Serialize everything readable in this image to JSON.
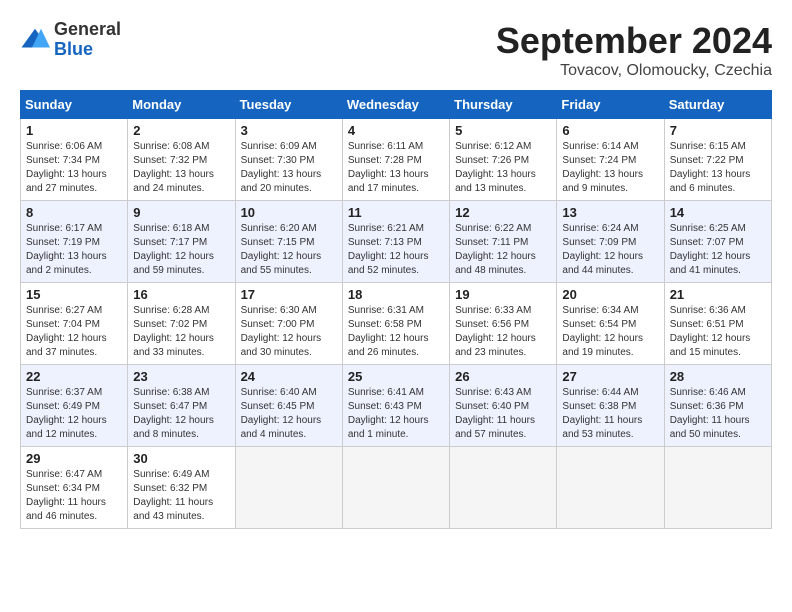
{
  "logo": {
    "text_general": "General",
    "text_blue": "Blue"
  },
  "title": "September 2024",
  "location": "Tovacov, Olomoucky, Czechia",
  "days_of_week": [
    "Sunday",
    "Monday",
    "Tuesday",
    "Wednesday",
    "Thursday",
    "Friday",
    "Saturday"
  ],
  "weeks": [
    [
      {
        "num": "1",
        "sunrise": "Sunrise: 6:06 AM",
        "sunset": "Sunset: 7:34 PM",
        "daylight": "Daylight: 13 hours and 27 minutes."
      },
      {
        "num": "2",
        "sunrise": "Sunrise: 6:08 AM",
        "sunset": "Sunset: 7:32 PM",
        "daylight": "Daylight: 13 hours and 24 minutes."
      },
      {
        "num": "3",
        "sunrise": "Sunrise: 6:09 AM",
        "sunset": "Sunset: 7:30 PM",
        "daylight": "Daylight: 13 hours and 20 minutes."
      },
      {
        "num": "4",
        "sunrise": "Sunrise: 6:11 AM",
        "sunset": "Sunset: 7:28 PM",
        "daylight": "Daylight: 13 hours and 17 minutes."
      },
      {
        "num": "5",
        "sunrise": "Sunrise: 6:12 AM",
        "sunset": "Sunset: 7:26 PM",
        "daylight": "Daylight: 13 hours and 13 minutes."
      },
      {
        "num": "6",
        "sunrise": "Sunrise: 6:14 AM",
        "sunset": "Sunset: 7:24 PM",
        "daylight": "Daylight: 13 hours and 9 minutes."
      },
      {
        "num": "7",
        "sunrise": "Sunrise: 6:15 AM",
        "sunset": "Sunset: 7:22 PM",
        "daylight": "Daylight: 13 hours and 6 minutes."
      }
    ],
    [
      {
        "num": "8",
        "sunrise": "Sunrise: 6:17 AM",
        "sunset": "Sunset: 7:19 PM",
        "daylight": "Daylight: 13 hours and 2 minutes."
      },
      {
        "num": "9",
        "sunrise": "Sunrise: 6:18 AM",
        "sunset": "Sunset: 7:17 PM",
        "daylight": "Daylight: 12 hours and 59 minutes."
      },
      {
        "num": "10",
        "sunrise": "Sunrise: 6:20 AM",
        "sunset": "Sunset: 7:15 PM",
        "daylight": "Daylight: 12 hours and 55 minutes."
      },
      {
        "num": "11",
        "sunrise": "Sunrise: 6:21 AM",
        "sunset": "Sunset: 7:13 PM",
        "daylight": "Daylight: 12 hours and 52 minutes."
      },
      {
        "num": "12",
        "sunrise": "Sunrise: 6:22 AM",
        "sunset": "Sunset: 7:11 PM",
        "daylight": "Daylight: 12 hours and 48 minutes."
      },
      {
        "num": "13",
        "sunrise": "Sunrise: 6:24 AM",
        "sunset": "Sunset: 7:09 PM",
        "daylight": "Daylight: 12 hours and 44 minutes."
      },
      {
        "num": "14",
        "sunrise": "Sunrise: 6:25 AM",
        "sunset": "Sunset: 7:07 PM",
        "daylight": "Daylight: 12 hours and 41 minutes."
      }
    ],
    [
      {
        "num": "15",
        "sunrise": "Sunrise: 6:27 AM",
        "sunset": "Sunset: 7:04 PM",
        "daylight": "Daylight: 12 hours and 37 minutes."
      },
      {
        "num": "16",
        "sunrise": "Sunrise: 6:28 AM",
        "sunset": "Sunset: 7:02 PM",
        "daylight": "Daylight: 12 hours and 33 minutes."
      },
      {
        "num": "17",
        "sunrise": "Sunrise: 6:30 AM",
        "sunset": "Sunset: 7:00 PM",
        "daylight": "Daylight: 12 hours and 30 minutes."
      },
      {
        "num": "18",
        "sunrise": "Sunrise: 6:31 AM",
        "sunset": "Sunset: 6:58 PM",
        "daylight": "Daylight: 12 hours and 26 minutes."
      },
      {
        "num": "19",
        "sunrise": "Sunrise: 6:33 AM",
        "sunset": "Sunset: 6:56 PM",
        "daylight": "Daylight: 12 hours and 23 minutes."
      },
      {
        "num": "20",
        "sunrise": "Sunrise: 6:34 AM",
        "sunset": "Sunset: 6:54 PM",
        "daylight": "Daylight: 12 hours and 19 minutes."
      },
      {
        "num": "21",
        "sunrise": "Sunrise: 6:36 AM",
        "sunset": "Sunset: 6:51 PM",
        "daylight": "Daylight: 12 hours and 15 minutes."
      }
    ],
    [
      {
        "num": "22",
        "sunrise": "Sunrise: 6:37 AM",
        "sunset": "Sunset: 6:49 PM",
        "daylight": "Daylight: 12 hours and 12 minutes."
      },
      {
        "num": "23",
        "sunrise": "Sunrise: 6:38 AM",
        "sunset": "Sunset: 6:47 PM",
        "daylight": "Daylight: 12 hours and 8 minutes."
      },
      {
        "num": "24",
        "sunrise": "Sunrise: 6:40 AM",
        "sunset": "Sunset: 6:45 PM",
        "daylight": "Daylight: 12 hours and 4 minutes."
      },
      {
        "num": "25",
        "sunrise": "Sunrise: 6:41 AM",
        "sunset": "Sunset: 6:43 PM",
        "daylight": "Daylight: 12 hours and 1 minute."
      },
      {
        "num": "26",
        "sunrise": "Sunrise: 6:43 AM",
        "sunset": "Sunset: 6:40 PM",
        "daylight": "Daylight: 11 hours and 57 minutes."
      },
      {
        "num": "27",
        "sunrise": "Sunrise: 6:44 AM",
        "sunset": "Sunset: 6:38 PM",
        "daylight": "Daylight: 11 hours and 53 minutes."
      },
      {
        "num": "28",
        "sunrise": "Sunrise: 6:46 AM",
        "sunset": "Sunset: 6:36 PM",
        "daylight": "Daylight: 11 hours and 50 minutes."
      }
    ],
    [
      {
        "num": "29",
        "sunrise": "Sunrise: 6:47 AM",
        "sunset": "Sunset: 6:34 PM",
        "daylight": "Daylight: 11 hours and 46 minutes."
      },
      {
        "num": "30",
        "sunrise": "Sunrise: 6:49 AM",
        "sunset": "Sunset: 6:32 PM",
        "daylight": "Daylight: 11 hours and 43 minutes."
      },
      null,
      null,
      null,
      null,
      null
    ]
  ]
}
